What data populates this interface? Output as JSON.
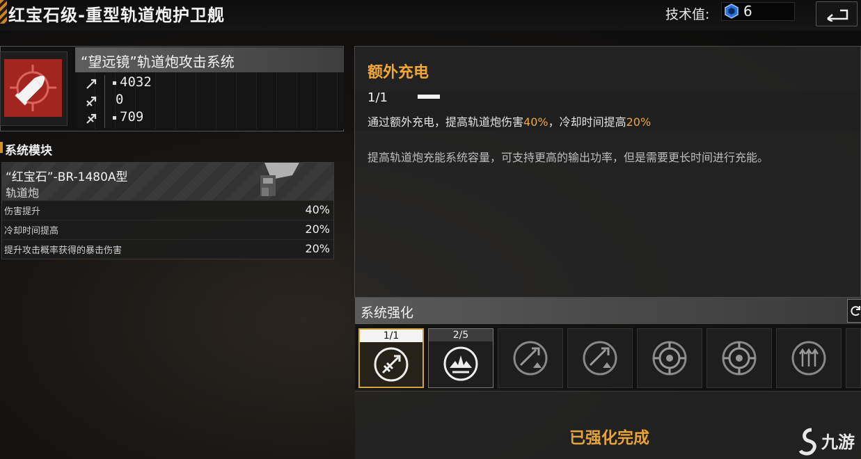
{
  "header": {
    "title": "红宝石级-重型轨道炮护卫舰",
    "tech_label": "技术值:",
    "tech_value": "6"
  },
  "weapon": {
    "name": "“望远镜”轨道炮攻击系统",
    "stats": [
      "4032",
      "0",
      "709"
    ],
    "icon": "bullet-target-icon",
    "icon_bg": "#a3251f"
  },
  "module": {
    "header": "系统模块",
    "name": "“红宝石”-BR-1480A型",
    "type": "轨道炮",
    "rows": [
      {
        "label": "伤害提升",
        "value": "40%"
      },
      {
        "label": "冷却时间提高",
        "value": "20%"
      },
      {
        "label": "提升攻击概率获得的暴击伤害",
        "value": "20%"
      }
    ]
  },
  "detail": {
    "title": "额外充电",
    "level": "1/1",
    "effect_prefix": "通过额外充电，提高轨道炮伤害",
    "effect_val1": "40%",
    "effect_mid": "，冷却时间提高",
    "effect_val2": "20%",
    "description": "提高轨道炮充能系统容量，可支持更高的输出功率，但是需要更长时间进行充能。"
  },
  "enhancement": {
    "title": "系统强化",
    "slots": [
      {
        "tag": "1/1",
        "icon": "railgun-bolt-icon",
        "selected": true
      },
      {
        "tag": "2/5",
        "icon": "burst-icon",
        "selected": false
      },
      {
        "tag": "",
        "icon": "damage-up-icon",
        "selected": false
      },
      {
        "tag": "",
        "icon": "damage-up-icon",
        "selected": false
      },
      {
        "tag": "",
        "icon": "radar-icon",
        "selected": false
      },
      {
        "tag": "",
        "icon": "radar-icon",
        "selected": false
      },
      {
        "tag": "",
        "icon": "triple-arrow-icon",
        "selected": false
      }
    ],
    "complete_text": "已强化完成"
  },
  "watermark": "九游",
  "colors": {
    "accent": "#f1a638",
    "complete": "#e6a33a",
    "selected_border": "#d1a440"
  }
}
